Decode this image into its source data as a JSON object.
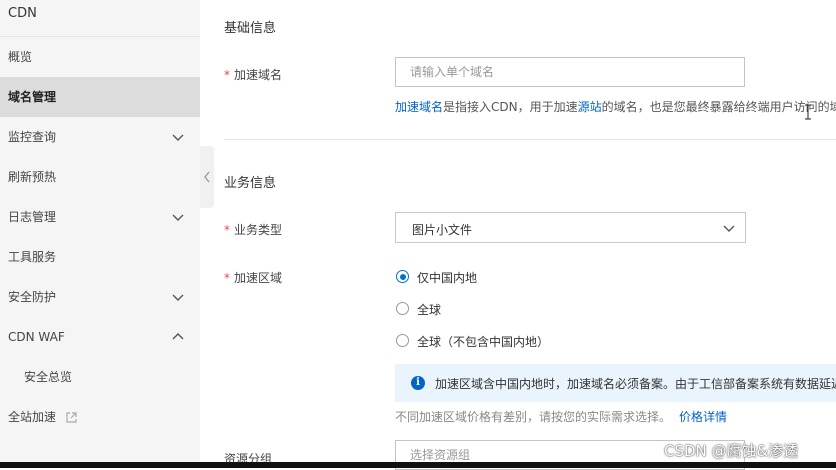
{
  "sidebar": {
    "title": "CDN",
    "items": [
      {
        "label": "概览"
      },
      {
        "label": "域名管理"
      },
      {
        "label": "监控查询"
      },
      {
        "label": "刷新预热"
      },
      {
        "label": "日志管理"
      },
      {
        "label": "工具服务"
      },
      {
        "label": "安全防护"
      },
      {
        "label": "CDN WAF"
      },
      {
        "label": "安全总览"
      },
      {
        "label": "全站加速"
      }
    ],
    "active": "域名管理"
  },
  "basic": {
    "section_title": "基础信息",
    "domain_label": "加速域名",
    "required_mark": "*",
    "domain_placeholder": "请输入单个域名",
    "help_link1": "加速域名",
    "help_text1": "是指接入CDN，用于加速",
    "help_link2": "源站",
    "help_text2": "的域名，也是您最终暴露给终端用户访问的域"
  },
  "business": {
    "section_title": "业务信息",
    "type_label": "业务类型",
    "type_value": "图片小文件",
    "region_label": "加速区域",
    "region_options": [
      {
        "label": "仅中国内地",
        "checked": true
      },
      {
        "label": "全球",
        "checked": false
      },
      {
        "label": "全球（不包含中国内地）",
        "checked": false
      }
    ],
    "notice_icon": "i",
    "notice": "加速区域含中国内地时，加速域名必须备案。由于工信部备案系统有数据延迟",
    "price_note": "不同加速区域价格有差别，请按您的实际需求选择。",
    "price_link": "价格详情",
    "group_label": "资源分组",
    "group_placeholder": "选择资源组"
  },
  "watermark": "CSDN @腐蚀&渗透",
  "colors": {
    "accent": "#0070cc",
    "link": "#0064c8",
    "required": "#e5484d",
    "sidebar_bg": "#f5f5f5",
    "active_bg": "#dcdcdc",
    "notice_bg": "#eaf4fd"
  }
}
